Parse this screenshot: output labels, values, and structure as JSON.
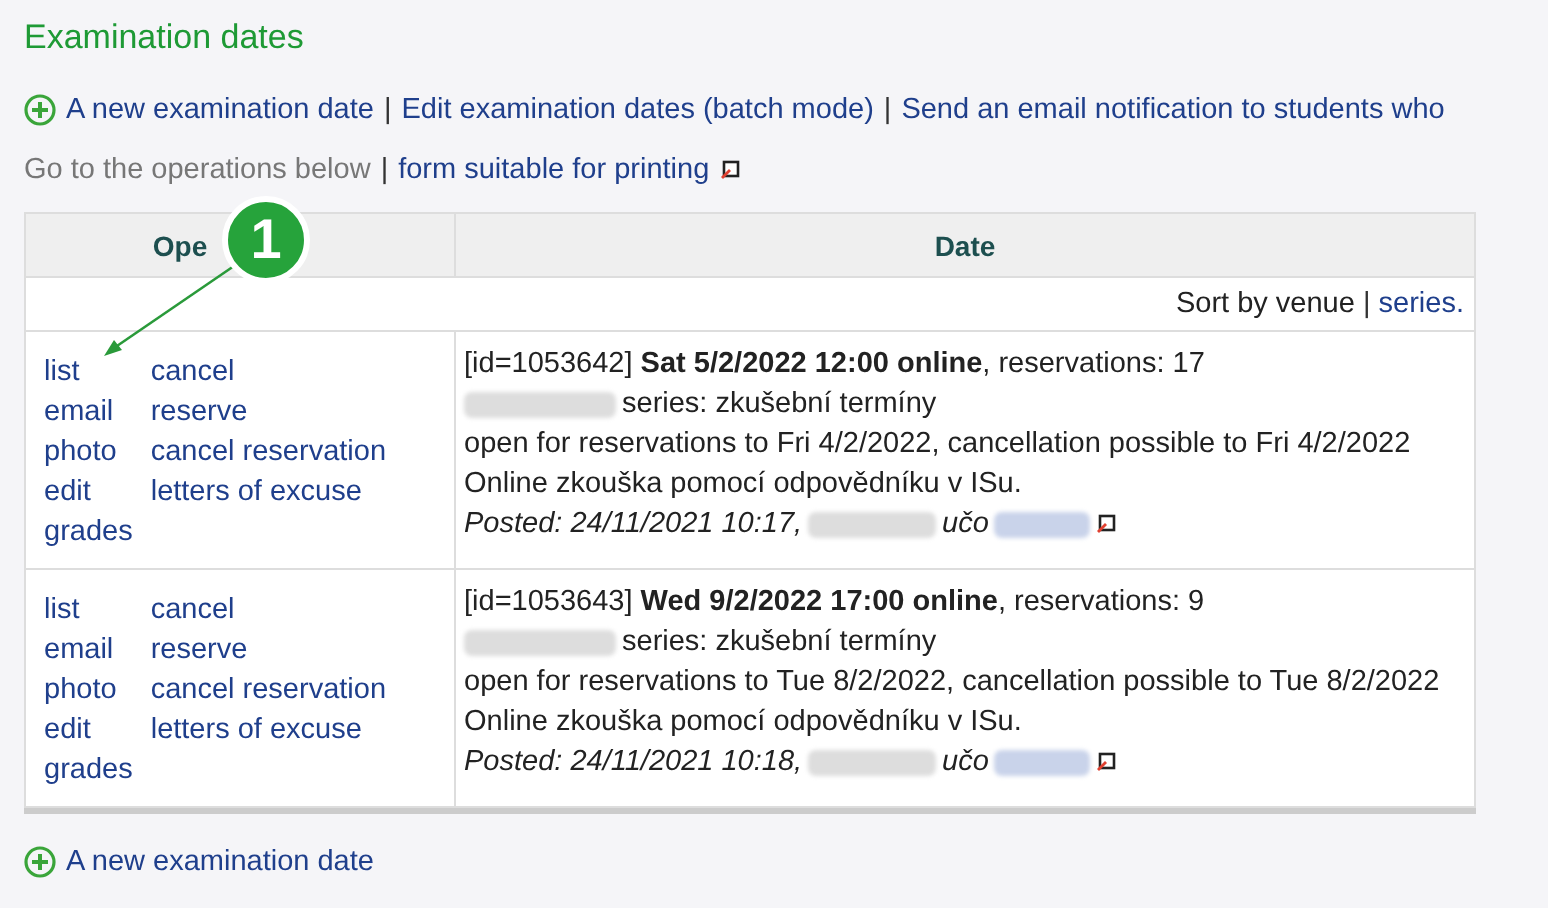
{
  "title": "Examination dates",
  "actions": [
    "A new examination date",
    "Edit examination dates (batch mode)",
    "Send an email notification to students who"
  ],
  "nav": {
    "text": "Go to the operations below",
    "link": "form suitable for printing"
  },
  "table": {
    "columns": [
      "Ope",
      "Date"
    ],
    "sort": {
      "text": "Sort by venue",
      "link": "series."
    },
    "rows": [
      {
        "ops_left": [
          "list",
          "email",
          "photo",
          "edit",
          "grades"
        ],
        "ops_right": [
          "cancel",
          "reserve",
          "cancel reservation",
          "letters of excuse"
        ],
        "headline": "[id=1053642] **Sat 5/2/2022 12:00 online**, reservations: 17",
        "series": "series: zkušební termíny",
        "open": "open for reservations to Fri 4/2/2022, cancellation possible to Fri 4/2/2022",
        "note": "Online zkouška pomocí odpovědníku v ISu.",
        "posted": "Posted: 24/11/2021 10:17,",
        "uco": "učo"
      },
      {
        "ops_left": [
          "list",
          "email",
          "photo",
          "edit",
          "grades"
        ],
        "ops_right": [
          "cancel",
          "reserve",
          "cancel reservation",
          "letters of excuse"
        ],
        "headline": "[id=1053643] **Wed 9/2/2022 17:00 online**, reservations: 9",
        "series": "series: zkušební termíny",
        "open": "open for reservations to Tue 8/2/2022, cancellation possible to Tue 8/2/2022",
        "note": "Online zkouška pomocí odpovědníku v ISu.",
        "posted": "Posted: 24/11/2021 10:18,",
        "uco": "učo"
      }
    ]
  },
  "callout": {
    "label": "1"
  },
  "separator": "|",
  "bottom_action": "A new examination date"
}
